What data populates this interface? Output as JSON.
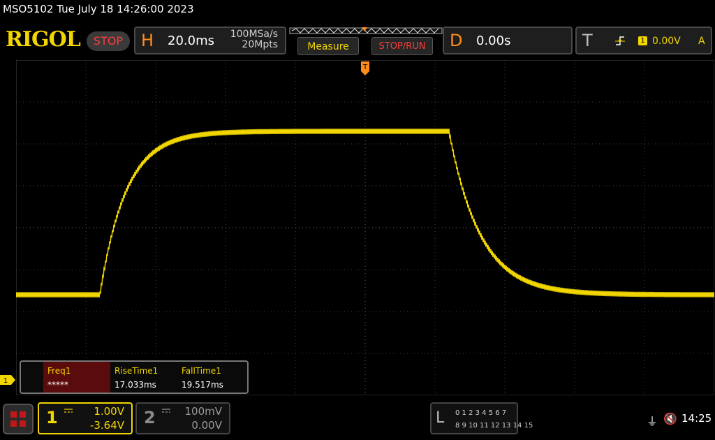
{
  "header": {
    "title": "MSO5102  Tue July 18 14:26:00 2023",
    "logo": "RIGOL",
    "run_state": "STOP"
  },
  "horizontal": {
    "label": "H",
    "timebase": "20.0ms",
    "sample_rate": "100MSa/s",
    "memory_depth": "20Mpts"
  },
  "buttons": {
    "measure": "Measure",
    "stop_run": "STOP/RUN"
  },
  "delay": {
    "label": "D",
    "value": "0.00s"
  },
  "trigger": {
    "label": "T",
    "channel": "1",
    "level": "0.00V",
    "mode": "A"
  },
  "measurements": [
    {
      "label": "Freq1",
      "value": "*****"
    },
    {
      "label": "RiseTime1",
      "value": "17.033ms"
    },
    {
      "label": "FallTime1",
      "value": "19.517ms"
    }
  ],
  "channels": {
    "ch1": {
      "number": "1",
      "scale": "1.00V",
      "offset": "-3.64V",
      "marker": "1"
    },
    "ch2": {
      "number": "2",
      "scale": "100mV",
      "offset": "0.00V"
    }
  },
  "logic_analyzer": {
    "label": "L",
    "row1": "0 1 2 3  4 5 6 7",
    "row2": "8 9 10 11 12 13 14 15"
  },
  "status": {
    "clock": "14:25"
  },
  "colors": {
    "ch1": "#f2d600",
    "accent_orange": "#ff8c1a",
    "stop_red": "#ff3b3b"
  },
  "waveform": {
    "baseline_div": -1.6,
    "high_div": 2.3,
    "rise_start_ms": -76,
    "fall_start_ms": 24,
    "rise_tau_ms": 7.5,
    "fall_tau_ms": 9.0,
    "ripple_div": 0.06
  }
}
